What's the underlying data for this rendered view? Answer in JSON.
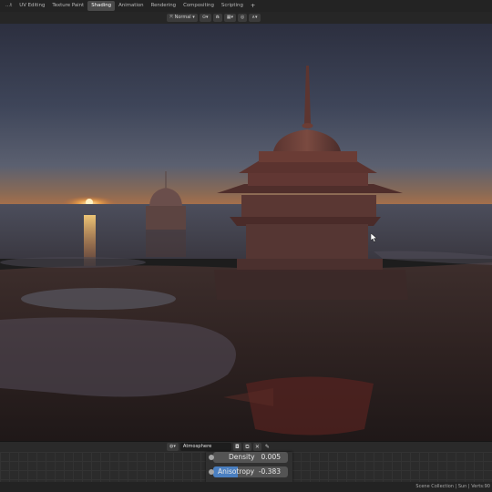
{
  "workspace_tabs": [
    {
      "label": "...t",
      "active": false
    },
    {
      "label": "UV Editing",
      "active": false
    },
    {
      "label": "Texture Paint",
      "active": false
    },
    {
      "label": "Shading",
      "active": true
    },
    {
      "label": "Animation",
      "active": false
    },
    {
      "label": "Rendering",
      "active": false
    },
    {
      "label": "Compositing",
      "active": false
    },
    {
      "label": "Scripting",
      "active": false
    }
  ],
  "add_workspace_label": "+",
  "viewport_header": {
    "orientation_value": "Normal",
    "orientation_icon": "transform-orientation-icon",
    "pivot_icon": "pivot-point-icon",
    "snap_icon": "snap-magnet-icon",
    "proportional_icon": "proportional-editing-icon"
  },
  "node_editor": {
    "world_type_icon": "world-icon",
    "world_name": "Atmosphere",
    "properties": [
      {
        "label": "Density",
        "value": "0.005"
      },
      {
        "label": "Anisotropy",
        "value": "-0.383"
      }
    ]
  },
  "status_bar": {
    "text": "Scene Collection | Sun | Verts:90"
  },
  "colors": {
    "accent_tab": "#4a4a4a",
    "slider_fill": "#4a7fc1"
  }
}
